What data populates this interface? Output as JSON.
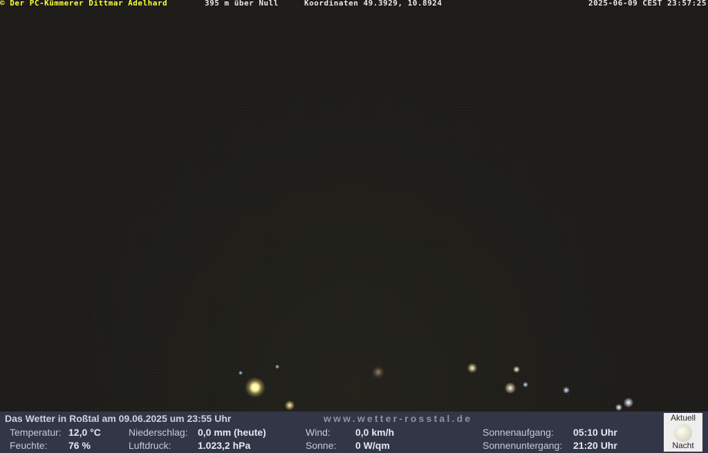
{
  "camera_overlay": {
    "copyright": "© Der PC-Kümmerer Dittmar Adelhard",
    "altitude": "395 m über Null",
    "coordinates": "Koordinaten 49.3929, 10.8924",
    "timestamp": "2025-06-09 CEST 23:57:25"
  },
  "weather": {
    "title": "Das Wetter in Roßtal am 09.06.2025 um 23:55 Uhr",
    "website": "www.wetter-rosstal.de",
    "temperature_label": "Temperatur:",
    "temperature_value": "12,0 °C",
    "humidity_label": "Feuchte:",
    "humidity_value": "76 %",
    "precipitation_label": "Niederschlag:",
    "precipitation_value": "0,0 mm (heute)",
    "pressure_label": "Luftdruck:",
    "pressure_value": "1.023,2 hPa",
    "wind_label": "Wind:",
    "wind_value": "0,0 km/h",
    "sun_label": "Sonne:",
    "sun_value": "0 W/qm",
    "sunrise_label": "Sonnenaufgang:",
    "sunrise_value": "05:10 Uhr",
    "sunset_label": "Sonnenuntergang:",
    "sunset_value": "21:20 Uhr",
    "moon_top": "Aktuell",
    "moon_bottom": "Nacht",
    "moon_icon": "full-moon-icon"
  }
}
